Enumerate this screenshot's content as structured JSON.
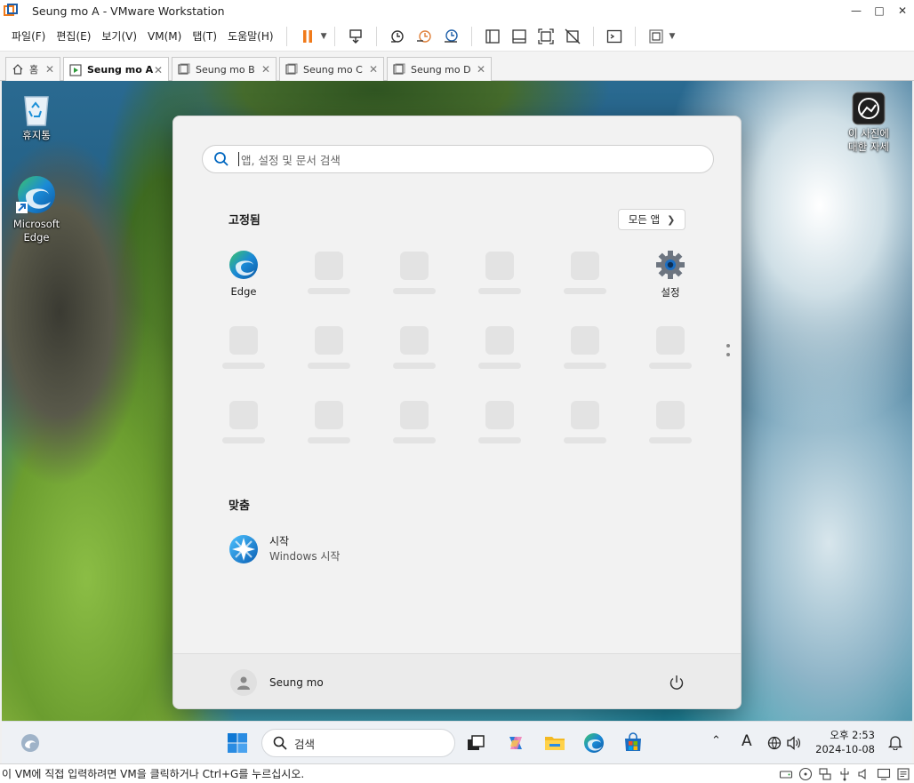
{
  "window": {
    "title": "Seung mo A - VMware Workstation"
  },
  "menu": [
    "파일(F)",
    "편집(E)",
    "보기(V)",
    "VM(M)",
    "탭(T)",
    "도움말(H)"
  ],
  "tabs": [
    {
      "label": "홈",
      "active": false
    },
    {
      "label": "Seung mo A",
      "active": true
    },
    {
      "label": "Seung mo B",
      "active": false
    },
    {
      "label": "Seung mo C",
      "active": false
    },
    {
      "label": "Seung mo D",
      "active": false
    }
  ],
  "desktop": {
    "recycle_bin": "휴지통",
    "edge_line1": "Microsoft",
    "edge_line2": "Edge",
    "learn_line1": "이 사진에",
    "learn_line2": "대한 자세"
  },
  "start_menu": {
    "search_placeholder": "앱, 설정 및 문서 검색",
    "pinned_title": "고정됨",
    "all_apps": "모든 앱",
    "pinned": [
      {
        "label": "Edge",
        "icon": "edge-icon"
      },
      {
        "label": "설정",
        "icon": "settings-gear-icon"
      }
    ],
    "recommended_title": "맞춤",
    "recommended": {
      "title": "시작",
      "subtitle": "Windows 시작"
    },
    "user": "Seung mo"
  },
  "taskbar": {
    "search_placeholder": "검색",
    "time": "오후 2:53",
    "date": "2024-10-08",
    "ime": "A"
  },
  "statusbar": {
    "message": "이 VM에 직접 입력하려면 VM을 클릭하거나 Ctrl+G를 누르십시오."
  },
  "colors": {
    "accent": "#0067c0",
    "pause": "#f07a1a",
    "edge_blue": "#1b8ad6",
    "edge_green": "#3cc46a"
  }
}
